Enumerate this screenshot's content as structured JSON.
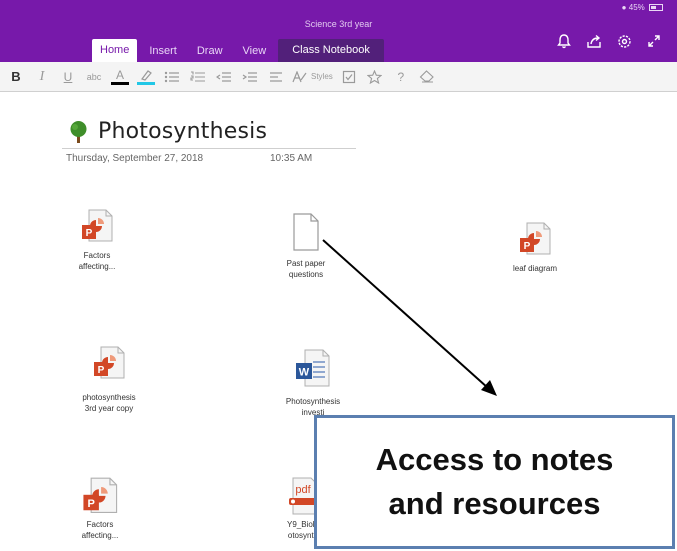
{
  "status_bar": {
    "text": "45%"
  },
  "titlebar": {
    "notebook": "Science 3rd year"
  },
  "ribbon": {
    "tabs": [
      "Home",
      "Insert",
      "Draw",
      "View",
      "Class Notebook"
    ],
    "active_tab": "Home",
    "icons": [
      "bell-icon",
      "share-icon",
      "settings-icon",
      "expand-icon"
    ]
  },
  "toolbar": {
    "bold": "B",
    "italic": "I",
    "underline": "U",
    "strikethrough": "abc",
    "font_color": "A",
    "styles_label": "Styles",
    "help": "?",
    "font_color_hex": "#000000",
    "highlight_hex": "#22c7e6"
  },
  "page": {
    "title": "Photosynthesis",
    "date": "Thursday, September 27, 2018",
    "time": "10:35 AM"
  },
  "files": [
    {
      "line1": "Factors",
      "line2": "affecting...",
      "type": "powerpoint"
    },
    {
      "line1": "Past paper",
      "line2": "questions",
      "type": "blank"
    },
    {
      "line1": "leaf diagram",
      "line2": "",
      "type": "powerpoint"
    },
    {
      "line1": "photosynthesis",
      "line2": "3rd year copy",
      "type": "powerpoint"
    },
    {
      "line1": "Photosynthesis",
      "line2": "investi",
      "type": "word"
    },
    {
      "line1": "Factors",
      "line2": "affecting...",
      "type": "powerpoint"
    },
    {
      "line1": "Y9_Biolo",
      "line2": "otosynth",
      "type": "pdf"
    }
  ],
  "callout": {
    "line1": "Access to notes",
    "line2": "and resources"
  },
  "colors": {
    "onenote_purple": "#7719aa",
    "class_notebook_tab": "#52207a",
    "powerpoint_red": "#d24726",
    "word_blue": "#2b579a",
    "callout_border": "#5b7fb0"
  }
}
